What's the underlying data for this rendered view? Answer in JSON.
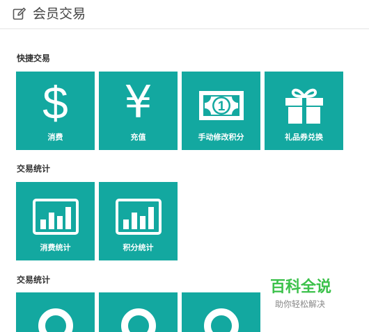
{
  "header": {
    "title": "会员交易",
    "icon": "edit-icon"
  },
  "theme": {
    "tile_color": "#13a8a0",
    "tile_text_color": "#ffffff",
    "watermark_color": "#3cc14b"
  },
  "sections": [
    {
      "title": "快捷交易",
      "tiles": [
        {
          "label": "消费",
          "icon": "dollar-icon"
        },
        {
          "label": "充值",
          "icon": "yen-icon"
        },
        {
          "label": "手动修改积分",
          "icon": "banknote-icon"
        },
        {
          "label": "礼品券兑换",
          "icon": "gift-icon"
        }
      ]
    },
    {
      "title": "交易统计",
      "tiles": [
        {
          "label": "消费统计",
          "icon": "bar-chart-icon"
        },
        {
          "label": "积分统计",
          "icon": "bar-chart-icon"
        }
      ]
    },
    {
      "title": "交易统计",
      "tiles": [
        {
          "label": "",
          "icon": "ring-icon"
        },
        {
          "label": "",
          "icon": "ring-icon"
        },
        {
          "label": "",
          "icon": "ring-icon"
        }
      ]
    }
  ],
  "watermark": {
    "brand": "百科全说",
    "subtitle": "助你轻松解决"
  }
}
